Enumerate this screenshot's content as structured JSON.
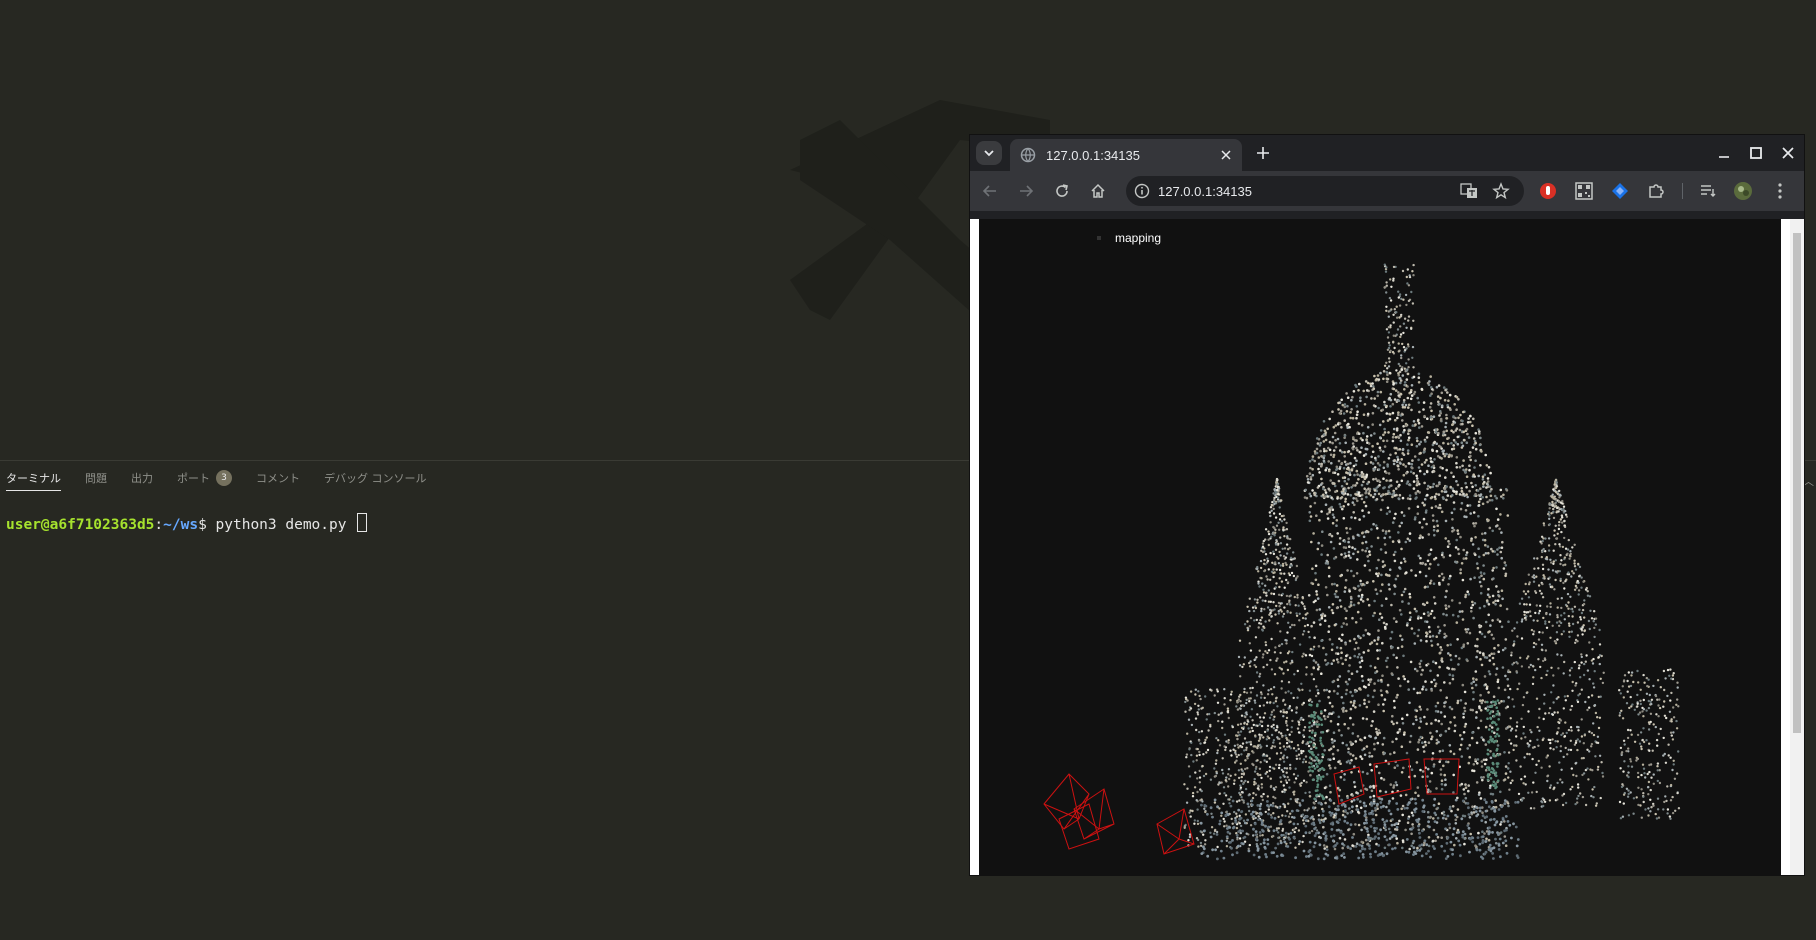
{
  "panel": {
    "tabs": [
      {
        "label": "ターミナル"
      },
      {
        "label": "問題"
      },
      {
        "label": "出力"
      },
      {
        "label": "ポート",
        "badge": "3"
      },
      {
        "label": "コメント"
      },
      {
        "label": "デバッグ コンソール"
      }
    ]
  },
  "terminal": {
    "user_host": "user@a6f7102363d5",
    "path": "~/ws",
    "prompt_suffix": "$ ",
    "command": "python3 demo.py"
  },
  "browser": {
    "tab_title": "127.0.0.1:34135",
    "url": "127.0.0.1:34135",
    "icons": [
      "tab-search-icon",
      "globe-icon",
      "close-icon",
      "plus-icon",
      "minimize-icon",
      "maximize-icon",
      "back-icon",
      "forward-icon",
      "reload-icon",
      "home-icon",
      "info-icon",
      "translate-icon",
      "star-icon",
      "extension-icon",
      "kebab-menu-icon"
    ]
  },
  "viewer": {
    "legend_label": "mapping",
    "background": "#111111",
    "camera_color": "#cc1111"
  }
}
